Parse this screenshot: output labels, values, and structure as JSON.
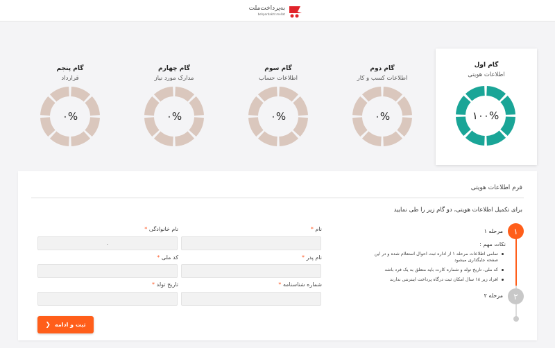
{
  "header": {
    "brand": "به‌پرداخت‌ملت",
    "brand_sub": "behpardakht mellat"
  },
  "steps": [
    {
      "title": "گام اول",
      "subtitle": "اطلاعات هویتی",
      "percent_label": "۱۰۰%",
      "progress": 1.0,
      "active": true
    },
    {
      "title": "گام دوم",
      "subtitle": "اطلاعات کسب و کار",
      "percent_label": "۰%",
      "progress": 0,
      "active": false
    },
    {
      "title": "گام سوم",
      "subtitle": "اطلاعات حساب",
      "percent_label": "۰%",
      "progress": 0,
      "active": false
    },
    {
      "title": "گام چهارم",
      "subtitle": "مدارک مورد نیاز",
      "percent_label": "۰%",
      "progress": 0,
      "active": false
    },
    {
      "title": "گام پنجم",
      "subtitle": "قرارداد",
      "percent_label": "۰%",
      "progress": 0,
      "active": false
    }
  ],
  "colors": {
    "active_ring": "#1aa597",
    "inactive_ring": "#dac7bd",
    "accent": "#ff5e1a",
    "inactive_stage": "#c8c8c8"
  },
  "form": {
    "title": "فرم اطلاعات هویتی",
    "hint": "برای تکمیل اطلاعات هویتی، دو گام زیر را طی نمایید",
    "fields": {
      "first_name": {
        "label": "نام",
        "value": ""
      },
      "last_name": {
        "label": "نام خانوادگی",
        "value": "."
      },
      "father_name": {
        "label": "نام پدر",
        "value": ""
      },
      "national_code": {
        "label": "کد ملی",
        "value": ""
      },
      "id_number": {
        "label": "شماره شناسنامه",
        "value": ""
      },
      "birth_date": {
        "label": "تاریخ تولد",
        "value": ""
      }
    },
    "required_mark": "*",
    "submit_label": "ثبت و ادامه",
    "submit_icon": "chevron-left-icon"
  },
  "timeline": {
    "stage1_number": "۱",
    "stage1_label": "مرحله ۱",
    "notes_title": "نکات مهم :",
    "notes": [
      "تمامی اطلاعات مرحله ۱ از اداره ثبت احوال استعلام شده و در این صفحه جایگذاری میشود",
      "کد ملی، تاریخ تولد و شماره کارت باید متعلق به یک فرد باشد",
      "افراد زیر ۱۸ سال امکان ثبت درگاه پرداخت اینترنتی ندارند"
    ],
    "stage2_number": "۲",
    "stage2_label": "مرحله ۲"
  }
}
